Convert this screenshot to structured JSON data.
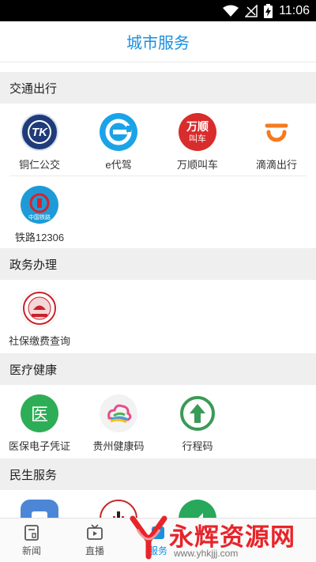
{
  "status_bar": {
    "time": "11:06"
  },
  "header": {
    "title": "城市服务"
  },
  "sections": [
    {
      "title": "交通出行",
      "items": [
        {
          "label": "铜仁公交",
          "icon": "tongren-bus-icon"
        },
        {
          "label": "e代驾",
          "icon": "e-daijia-icon"
        },
        {
          "label": "万顺叫车",
          "icon": "wanshun-taxi-icon"
        },
        {
          "label": "滴滴出行",
          "icon": "didi-icon"
        },
        {
          "label": "铁路12306",
          "icon": "railway-12306-icon"
        }
      ]
    },
    {
      "title": "政务办理",
      "items": [
        {
          "label": "社保缴费查询",
          "icon": "social-security-icon"
        }
      ]
    },
    {
      "title": "医疗健康",
      "items": [
        {
          "label": "医保电子凭证",
          "icon": "medical-insurance-icon",
          "glyph": "医"
        },
        {
          "label": "贵州健康码",
          "icon": "guizhou-health-code-icon"
        },
        {
          "label": "行程码",
          "icon": "travel-code-icon"
        }
      ]
    },
    {
      "title": "民生服务",
      "items": [
        {
          "label": "",
          "icon": "phone-service-icon"
        },
        {
          "label": "",
          "icon": "utility-icon"
        },
        {
          "label": "",
          "icon": "green-service-icon"
        }
      ]
    }
  ],
  "icon_text": {
    "tongren_bus": "TK",
    "wanshun_top": "万顺",
    "wanshun_bottom": "叫车",
    "railway": "中国铁路"
  },
  "bottom_nav": [
    {
      "label": "新闻",
      "icon": "news-icon",
      "active": false
    },
    {
      "label": "直播",
      "icon": "live-tv-icon",
      "active": false
    },
    {
      "label": "服务",
      "icon": "service-icon",
      "active": true
    }
  ],
  "watermark": {
    "text": "永辉资源网",
    "url": "www.yhkjjj.com"
  },
  "colors": {
    "accent": "#1a8fe0",
    "section_bg": "#efefef",
    "didi_orange": "#f47b20",
    "medical_green": "#2dae56"
  }
}
